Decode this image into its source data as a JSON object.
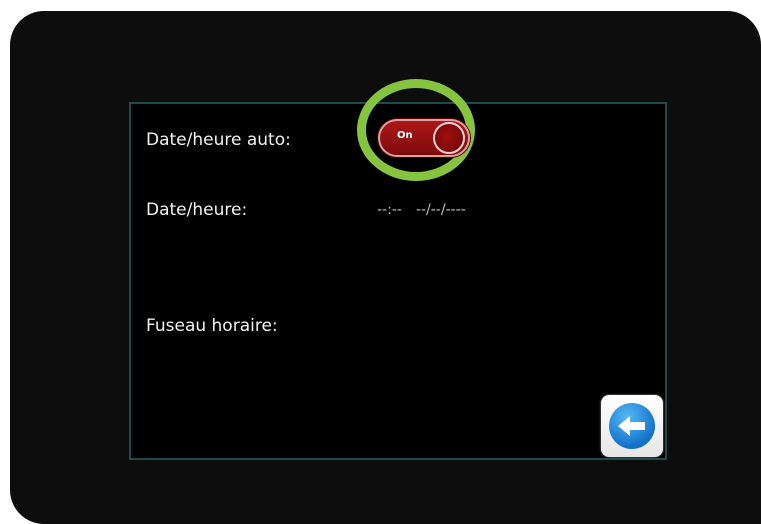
{
  "settings": {
    "auto_datetime_label": "Date/heure auto:",
    "datetime_label": "Date/heure:",
    "time_value": "--:--",
    "date_value": "--/--/----",
    "timezone_label": "Fuseau horaire:",
    "auto_toggle": {
      "state_text": "On",
      "is_on": true
    }
  },
  "icons": {
    "back_button": "back-arrow-icon"
  },
  "colors": {
    "highlight_ring": "#86c440",
    "toggle_on": "#a01414",
    "screen_border": "#1f4a4a",
    "back_icon": "#1a82d8"
  }
}
